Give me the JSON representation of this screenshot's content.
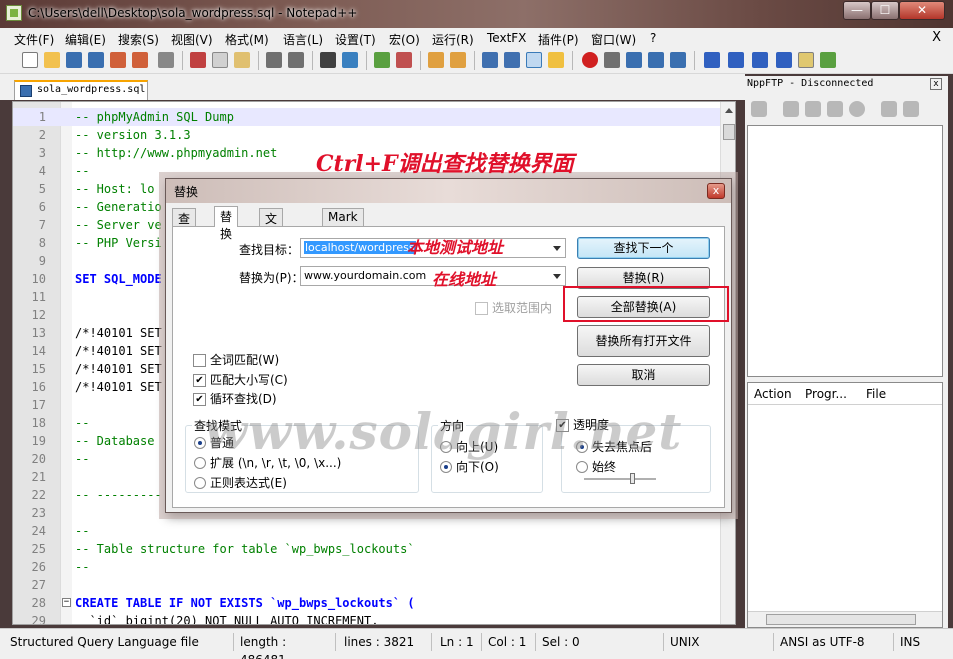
{
  "window": {
    "title": "C:\\Users\\dell\\Desktop\\sola_wordpress.sql - Notepad++",
    "min": "—",
    "max": "☐",
    "close": "✕"
  },
  "menu": [
    "文件(F)",
    "编辑(E)",
    "搜索(S)",
    "视图(V)",
    "格式(M)",
    "语言(L)",
    "设置(T)",
    "宏(O)",
    "运行(R)",
    "TextFX",
    "插件(P)",
    "窗口(W)",
    "?"
  ],
  "menu_close": "X",
  "tab": {
    "label": "sola_wordpress.sql"
  },
  "editor": {
    "lines": [
      {
        "n": "1",
        "t": "-- phpMyAdmin SQL Dump"
      },
      {
        "n": "2",
        "t": "-- version 3.1.3"
      },
      {
        "n": "3",
        "t": "-- http://www.phpmyadmin.net"
      },
      {
        "n": "4",
        "t": "--"
      },
      {
        "n": "5",
        "t": "-- Host: lo"
      },
      {
        "n": "6",
        "t": "-- Generatio"
      },
      {
        "n": "7",
        "t": "-- Server ve"
      },
      {
        "n": "8",
        "t": "-- PHP Versi"
      },
      {
        "n": "9",
        "t": ""
      },
      {
        "n": "10",
        "t": "SET SQL_MODE"
      },
      {
        "n": "11",
        "t": ""
      },
      {
        "n": "12",
        "t": ""
      },
      {
        "n": "13",
        "t": "/*!40101 SET"
      },
      {
        "n": "14",
        "t": "/*!40101 SET"
      },
      {
        "n": "15",
        "t": "/*!40101 SET"
      },
      {
        "n": "16",
        "t": "/*!40101 SET"
      },
      {
        "n": "17",
        "t": ""
      },
      {
        "n": "18",
        "t": "--"
      },
      {
        "n": "19",
        "t": "-- Database"
      },
      {
        "n": "20",
        "t": "--"
      },
      {
        "n": "21",
        "t": ""
      },
      {
        "n": "22",
        "t": "-- ---------"
      },
      {
        "n": "23",
        "t": ""
      },
      {
        "n": "24",
        "t": "--"
      },
      {
        "n": "25",
        "t": "-- Table structure for table `wp_bwps_lockouts`"
      },
      {
        "n": "26",
        "t": "--"
      },
      {
        "n": "27",
        "t": ""
      },
      {
        "n": "28",
        "t": "CREATE TABLE IF NOT EXISTS `wp_bwps_lockouts` ("
      },
      {
        "n": "29",
        "t": "  `id` bigint(20) NOT NULL AUTO_INCREMENT,"
      }
    ]
  },
  "ftp": {
    "header": "NppFTP - Disconnected",
    "close": "x",
    "columns": [
      "Action",
      "Progr...",
      "File"
    ]
  },
  "status": {
    "lang": "Structured Query Language file",
    "length": "length : 486481",
    "lines": "lines : 3821",
    "ln": "Ln : 1",
    "col": "Col : 1",
    "sel": "Sel : 0",
    "eol": "UNIX",
    "enc": "ANSI as UTF-8",
    "ins": "INS"
  },
  "annotations": {
    "top": "Ctrl+F调出查找替换界面",
    "find_note": "本地测试地址",
    "replace_note": "在线地址"
  },
  "dialog": {
    "title": "替换",
    "close": "x",
    "tabs": [
      "查找",
      "替换",
      "文件查找",
      "Mark"
    ],
    "find_label": "查找目标：",
    "find_value": "localhost/wordpress",
    "replace_label": "替换为(P)：",
    "replace_value": "www.yourdomain.com",
    "in_selection": "选取范围内",
    "buttons": {
      "find_next": "查找下一个",
      "replace": "替换(R)",
      "replace_all": "全部替换(A)",
      "replace_all_open": "替换所有打开文件",
      "cancel": "取消"
    },
    "options": {
      "whole_word": "全词匹配(W)",
      "match_case": "匹配大小写(C)",
      "wrap": "循环查找(D)"
    },
    "search_mode": {
      "title": "查找模式",
      "normal": "普通",
      "extended": "扩展 (\\n, \\r, \\t, \\0, \\x...)",
      "regex": "正则表达式(E)"
    },
    "direction": {
      "title": "方向",
      "up": "向上(U)",
      "down": "向下(O)"
    },
    "transparency": {
      "title": "透明度",
      "on_lose_focus": "失去焦点后",
      "always": "始终"
    }
  },
  "watermark": "www.solagirl.net"
}
